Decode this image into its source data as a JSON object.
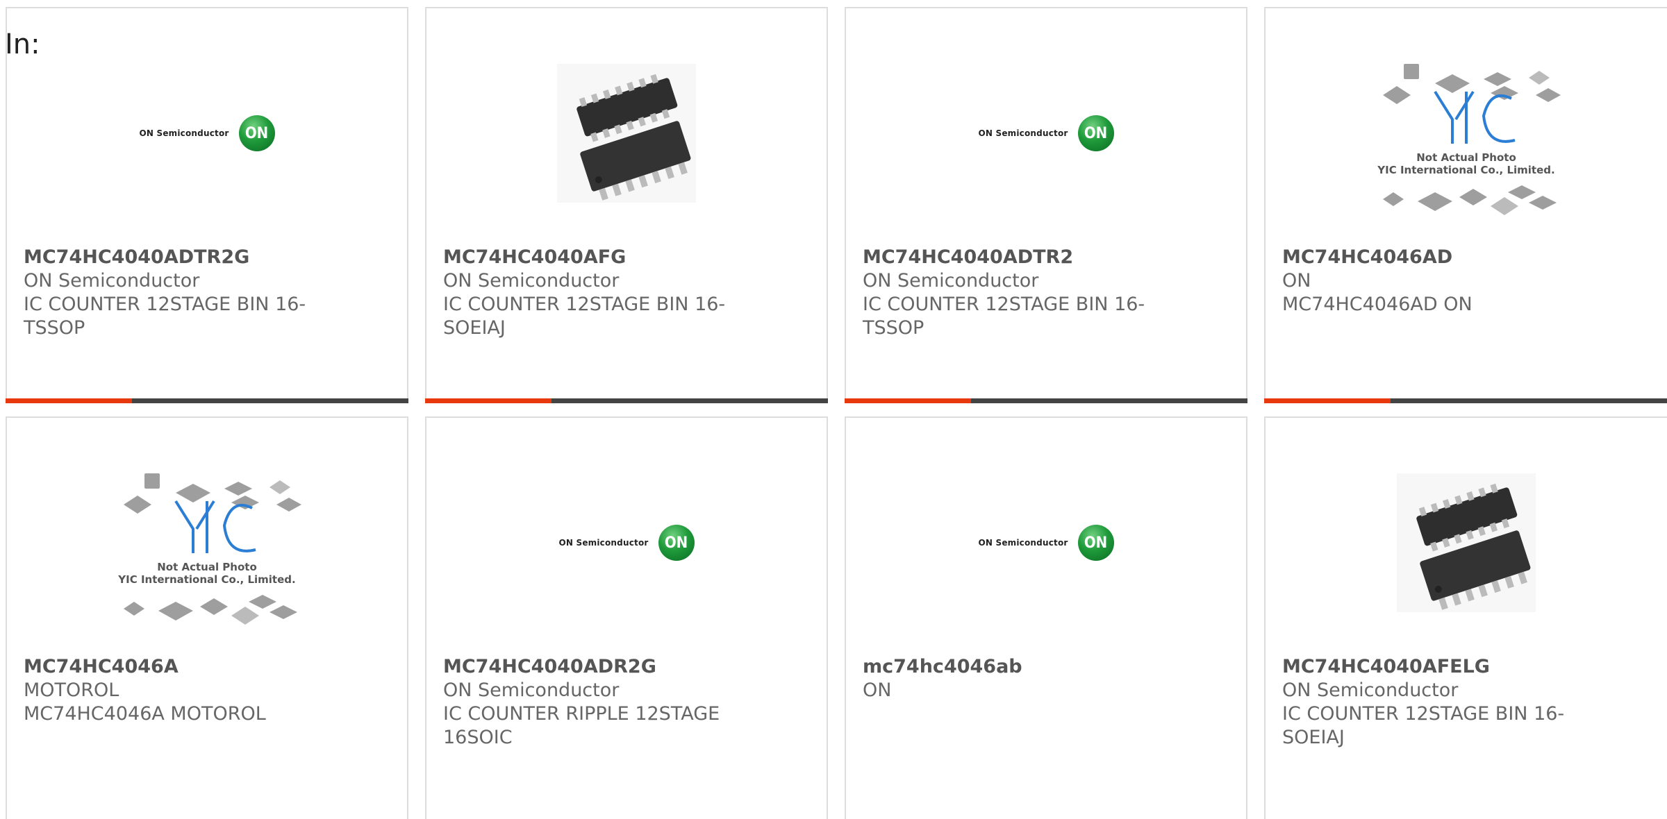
{
  "header": {
    "in_label": "In:"
  },
  "colors": {
    "accent": "#e8380d",
    "bar": "#444444",
    "border": "#dddddd",
    "text": "#666666"
  },
  "logo": {
    "on_text": "ON Semiconductor",
    "on_mark": "ON"
  },
  "yic": {
    "caption_line1": "Not Actual Photo",
    "caption_line2": "YIC International Co., Limited."
  },
  "products": [
    {
      "part": "MC74HC4040ADTR2G",
      "manufacturer": "ON Semiconductor",
      "description": "IC COUNTER 12STAGE BIN 16-TSSOP",
      "image": "on-semiconductor-logo"
    },
    {
      "part": "MC74HC4040AFG",
      "manufacturer": "ON Semiconductor",
      "description": "IC COUNTER 12STAGE BIN 16-SOEIAJ",
      "image": "soic-chip-photo"
    },
    {
      "part": "MC74HC4040ADTR2",
      "manufacturer": "ON Semiconductor",
      "description": "IC COUNTER 12STAGE BIN 16-TSSOP",
      "image": "on-semiconductor-logo"
    },
    {
      "part": "MC74HC4046AD",
      "manufacturer": "ON",
      "description": "MC74HC4046AD ON",
      "image": "yic-placeholder"
    },
    {
      "part": "MC74HC4046A",
      "manufacturer": "MOTOROL",
      "description": "MC74HC4046A MOTOROL",
      "image": "yic-placeholder"
    },
    {
      "part": "MC74HC4040ADR2G",
      "manufacturer": "ON Semiconductor",
      "description": "IC COUNTER RIPPLE 12STAGE 16SOIC",
      "image": "on-semiconductor-logo"
    },
    {
      "part": "mc74hc4046ab",
      "manufacturer": "ON",
      "description": "",
      "image": "on-semiconductor-logo"
    },
    {
      "part": "MC74HC4040AFELG",
      "manufacturer": "ON Semiconductor",
      "description": "IC COUNTER 12STAGE BIN 16-SOEIAJ",
      "image": "soic-chip-photo"
    }
  ]
}
